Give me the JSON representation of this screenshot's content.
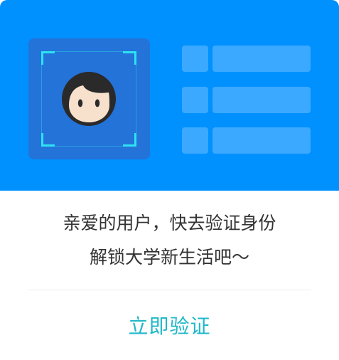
{
  "dialog": {
    "message_line1": "亲爱的用户，快去验证身份",
    "message_line2": "解锁大学新生活吧～",
    "button_label": "立即验证"
  },
  "colors": {
    "banner": "#0091ff",
    "face_panel": "#2373d9",
    "id_placeholder": "#3aa9ff",
    "scan_corner": "#2ee3f2",
    "button_text": "#1fb8c8",
    "message_text": "#333333"
  },
  "icons": {
    "face": "face-avatar-icon"
  }
}
